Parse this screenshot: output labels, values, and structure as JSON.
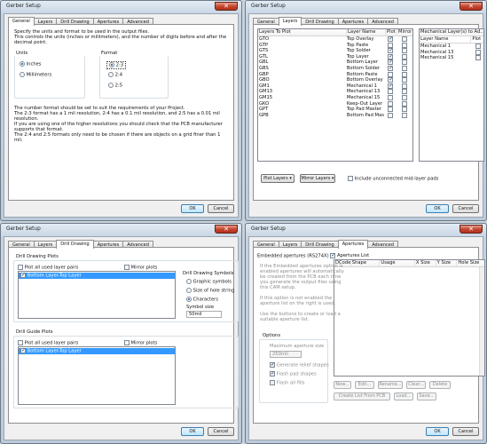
{
  "title": "Gerber Setup",
  "close_glyph": "✕",
  "buttons": {
    "ok": "OK",
    "cancel": "Cancel"
  },
  "tabs": [
    "General",
    "Layers",
    "Drill Drawing",
    "Apertures",
    "Advanced"
  ],
  "general": {
    "intro": [
      "Specify the units and format to be used in the output files.",
      "This controls the units (inches or millimeters), and the number of digits before and after the",
      "decimal point."
    ],
    "units_label": "Units",
    "unit_options": [
      "Inches",
      "Millimeters"
    ],
    "format_label": "Format",
    "format_options": [
      "2:3",
      "2:4",
      "2:5"
    ],
    "notes": [
      "The number format should be set to suit the requirements of your Project.",
      "The 2:3 format has a 1 mil resolution, 2:4 has a 0.1 mil resolution, and 2:5 has a 0.01 mil",
      "resolution.",
      "If you are using one of the higher resolutions you should check that the PCB manufacturer",
      "supports that format.",
      "The 2:4 and 2:5 formats only need to be chosen if there are objects on a grid finer than 1",
      "mil."
    ]
  },
  "layers": {
    "plot_header": "Layers To Plot",
    "columns": [
      "Layer Name",
      "Plot",
      "Mirror"
    ],
    "rows": [
      {
        "ext": "GTO",
        "name": "Top Overlay",
        "plot": true
      },
      {
        "ext": "GTP",
        "name": "Top Paste",
        "plot": false
      },
      {
        "ext": "GTS",
        "name": "Top Solder",
        "plot": true
      },
      {
        "ext": "GTL",
        "name": "Top Layer",
        "plot": true
      },
      {
        "ext": "GBL",
        "name": "Bottom Layer",
        "plot": true
      },
      {
        "ext": "GBS",
        "name": "Bottom Solder",
        "plot": true
      },
      {
        "ext": "GBP",
        "name": "Bottom Paste",
        "plot": false
      },
      {
        "ext": "GBO",
        "name": "Bottom Overlay",
        "plot": true
      },
      {
        "ext": "GM1",
        "name": "Mechanical 1",
        "plot": true
      },
      {
        "ext": "GM13",
        "name": "Mechanical 13",
        "plot": false
      },
      {
        "ext": "GM15",
        "name": "Mechanical 15",
        "plot": false
      },
      {
        "ext": "GKO",
        "name": "Keep-Out Layer",
        "plot": false
      },
      {
        "ext": "GPT",
        "name": "Top Pad Master",
        "plot": false
      },
      {
        "ext": "GPB",
        "name": "Bottom Pad Master",
        "plot": false
      }
    ],
    "mech_header": "Mechanical Layer(s) to Ad...",
    "mech_columns": [
      "Layer Name",
      "Plot"
    ],
    "mech_rows": [
      "Mechanical 1",
      "Mechanical 13",
      "Mechanical 15"
    ],
    "plot_layers_btn": "Plot Layers",
    "mirror_layers_btn": "Mirror Layers",
    "include_unconnected": "Include unconnected mid-layer pads"
  },
  "drill": {
    "drawing_plots": "Drill Drawing Plots",
    "plot_all": "Plot all used layer pairs",
    "mirror_plots": "Mirror plots",
    "pair": "Bottom Layer-Top Layer",
    "symbols_label": "Drill Drawing Symbols",
    "symbol_options": [
      "Graphic symbols",
      "Size of hole string",
      "Characters"
    ],
    "symbol_size_label": "Symbol size",
    "symbol_size": "50mil",
    "guide_plots": "Drill Guide Plots"
  },
  "apertures": {
    "embedded": "Embedded apertures (RS274X)",
    "list_label": "Apertures List",
    "columns": [
      "DCode",
      "Shape",
      "Usage",
      "X Size",
      "Y Size",
      "Hole Size"
    ],
    "help": [
      "If the Embedded apertures option is",
      "enabled apertures will automatically",
      "be created from the PCB each time",
      "you generate the output files using",
      "this CAM setup.",
      "",
      "If this option is not enabled the",
      "aperture list on the right is used.",
      "",
      "Use the buttons to create or load a",
      "suitable aperture list."
    ],
    "options_label": "Options",
    "max_size_label": "Maximum aperture size",
    "max_size": "250mil",
    "opt_list": [
      "Generate relief shapes",
      "Flash pad shapes",
      "Flash all fills"
    ],
    "btns": [
      "New...",
      "Edit...",
      "Rename...",
      "Clear...",
      "Delete",
      "Create List From PCB",
      "Load...",
      "Save..."
    ]
  }
}
